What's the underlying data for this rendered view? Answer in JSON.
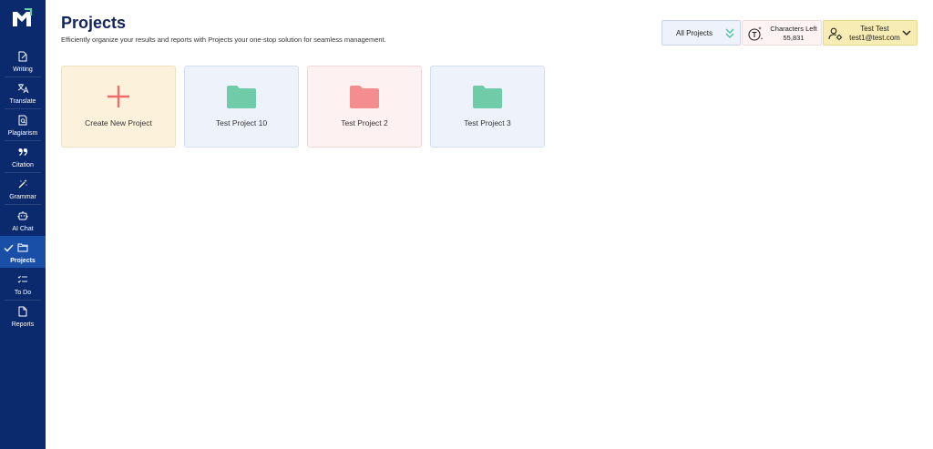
{
  "header": {
    "title": "Projects",
    "subtitle": "Efficiently organize your results and reports with Projects your one-stop solution for seamless management."
  },
  "sidebar": {
    "items": [
      {
        "label": "Writing",
        "icon": "writing-icon"
      },
      {
        "label": "Translate",
        "icon": "translate-icon"
      },
      {
        "label": "Plagiarism",
        "icon": "plagiarism-icon"
      },
      {
        "label": "Citation",
        "icon": "citation-icon"
      },
      {
        "label": "Grammar",
        "icon": "grammar-wand-icon"
      },
      {
        "label": "AI Chat",
        "icon": "ai-chat-bot-icon"
      },
      {
        "label": "Projects",
        "icon": "folder-icon",
        "active": true
      },
      {
        "label": "To Do",
        "icon": "todo-list-icon"
      },
      {
        "label": "Reports",
        "icon": "reports-icon"
      }
    ]
  },
  "toolbar": {
    "filter_label": "All Projects",
    "characters_label": "Characters Left",
    "characters_value": "55,831",
    "user_name": "Test Test",
    "user_email": "test1@test.com"
  },
  "cards": [
    {
      "label": "Create New Project",
      "icon": "plus-icon"
    },
    {
      "label": "Test Project 10",
      "icon": "folder-icon"
    },
    {
      "label": "Test Project 2",
      "icon": "folder-icon"
    },
    {
      "label": "Test Project 3",
      "icon": "folder-icon"
    }
  ],
  "colors": {
    "sidebar_bg": "#0b2a6e",
    "sidebar_active": "#1a4fa8",
    "title": "#13245c",
    "folder_green": "#6fcba8",
    "folder_red": "#f48e8e",
    "plus_red": "#f06a6a"
  }
}
